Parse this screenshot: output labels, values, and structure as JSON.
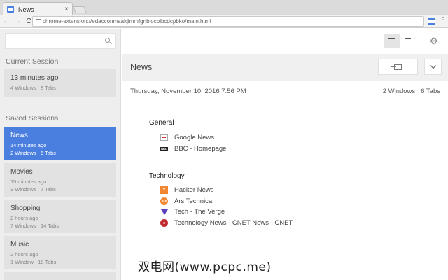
{
  "browser": {
    "tab_title": "News",
    "tab_close": "×",
    "url": "chrome-extension://edacconmaakjimmfgnblocblbcdcpbko/main.html",
    "back": "←",
    "forward": "→",
    "reload": "C",
    "menu": "⋮"
  },
  "sidebar": {
    "search": {
      "placeholder": "",
      "value": ""
    },
    "current_label": "Current Session",
    "current": {
      "name": "13 minutes ago",
      "windows": "4 Windows",
      "tabs": "8 Tabs"
    },
    "saved_label": "Saved Sessions",
    "saved": [
      {
        "name": "News",
        "time": "14 minutes ago",
        "windows": "2 Windows",
        "tabs": "6 Tabs",
        "active": true
      },
      {
        "name": "Movies",
        "time": "15 minutes ago",
        "windows": "3 Windows",
        "tabs": "7 Tabs",
        "active": false
      },
      {
        "name": "Shopping",
        "time": "2 hours ago",
        "windows": "7 Windows",
        "tabs": "14 Tabs",
        "active": false
      },
      {
        "name": "Music",
        "time": "2 hours ago",
        "windows": "1 Window",
        "tabs": "18 Tabs",
        "active": false
      }
    ]
  },
  "main": {
    "gear": "⚙",
    "title": "News",
    "date": "Thursday, November 10, 2016 7:56 PM",
    "windows": "2 Windows",
    "tabs": "6 Tabs",
    "groups": [
      {
        "title": "General",
        "links": [
          {
            "label": "Google News",
            "icon": "google-news-icon",
            "glyph": ""
          },
          {
            "label": "BBC - Homepage",
            "icon": "bbc-icon",
            "glyph": "BBC"
          }
        ]
      },
      {
        "title": "Technology",
        "links": [
          {
            "label": "Hacker News",
            "icon": "hacker-news-icon",
            "glyph": "Y"
          },
          {
            "label": "Ars Technica",
            "icon": "ars-technica-icon",
            "glyph": "ars"
          },
          {
            "label": "Tech - The Verge",
            "icon": "verge-icon",
            "glyph": ""
          },
          {
            "label": "Technology News - CNET News - CNET",
            "icon": "cnet-icon",
            "glyph": "c"
          }
        ]
      }
    ]
  },
  "watermark": "双电网(www.pcpc.me)",
  "colors": {
    "accent": "#4a7fe0",
    "sidebar_bg": "#eeeeee",
    "card_bg": "#e2e2e2",
    "header_bg": "#f0f0f0"
  }
}
